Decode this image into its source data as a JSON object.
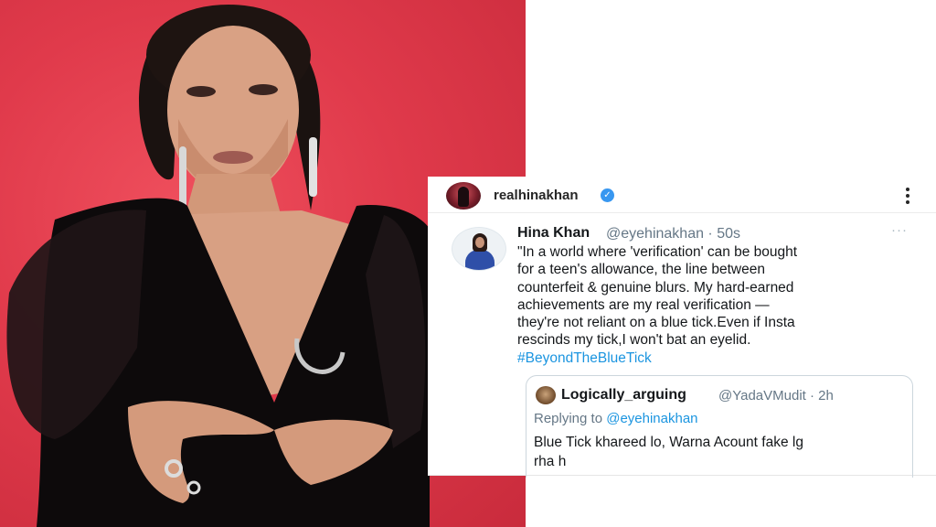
{
  "instagram": {
    "username": "realhinakhan",
    "verified_mark": "✓",
    "more_icon": "more-vertical-icon"
  },
  "tweet": {
    "name": "Hina Khan",
    "handle_time": "@eyehinakhan · 50s",
    "more": "···",
    "lines": [
      "\"In a world where 'verification' can be bought",
      "for a teen's allowance, the line between",
      "counterfeit & genuine blurs. My hard-earned",
      "achievements are my real verification —",
      "they're not reliant on a blue tick.Even if Insta",
      "rescinds my tick,I won't bat an eyelid."
    ],
    "hashtag": "#BeyondTheBlueTick"
  },
  "quoted": {
    "name": "Logically_arguing",
    "handle_time": "@YadaVMudit · 2h",
    "replying_label": "Replying to ",
    "replying_handle": "@eyehinakhan",
    "text_lines": [
      "Blue Tick khareed lo, Warna Acount fake lg",
      "rha h"
    ]
  },
  "colors": {
    "photo_background": "#e03a4b",
    "link_blue": "#1b95e0",
    "verified_blue": "#3897f0"
  }
}
